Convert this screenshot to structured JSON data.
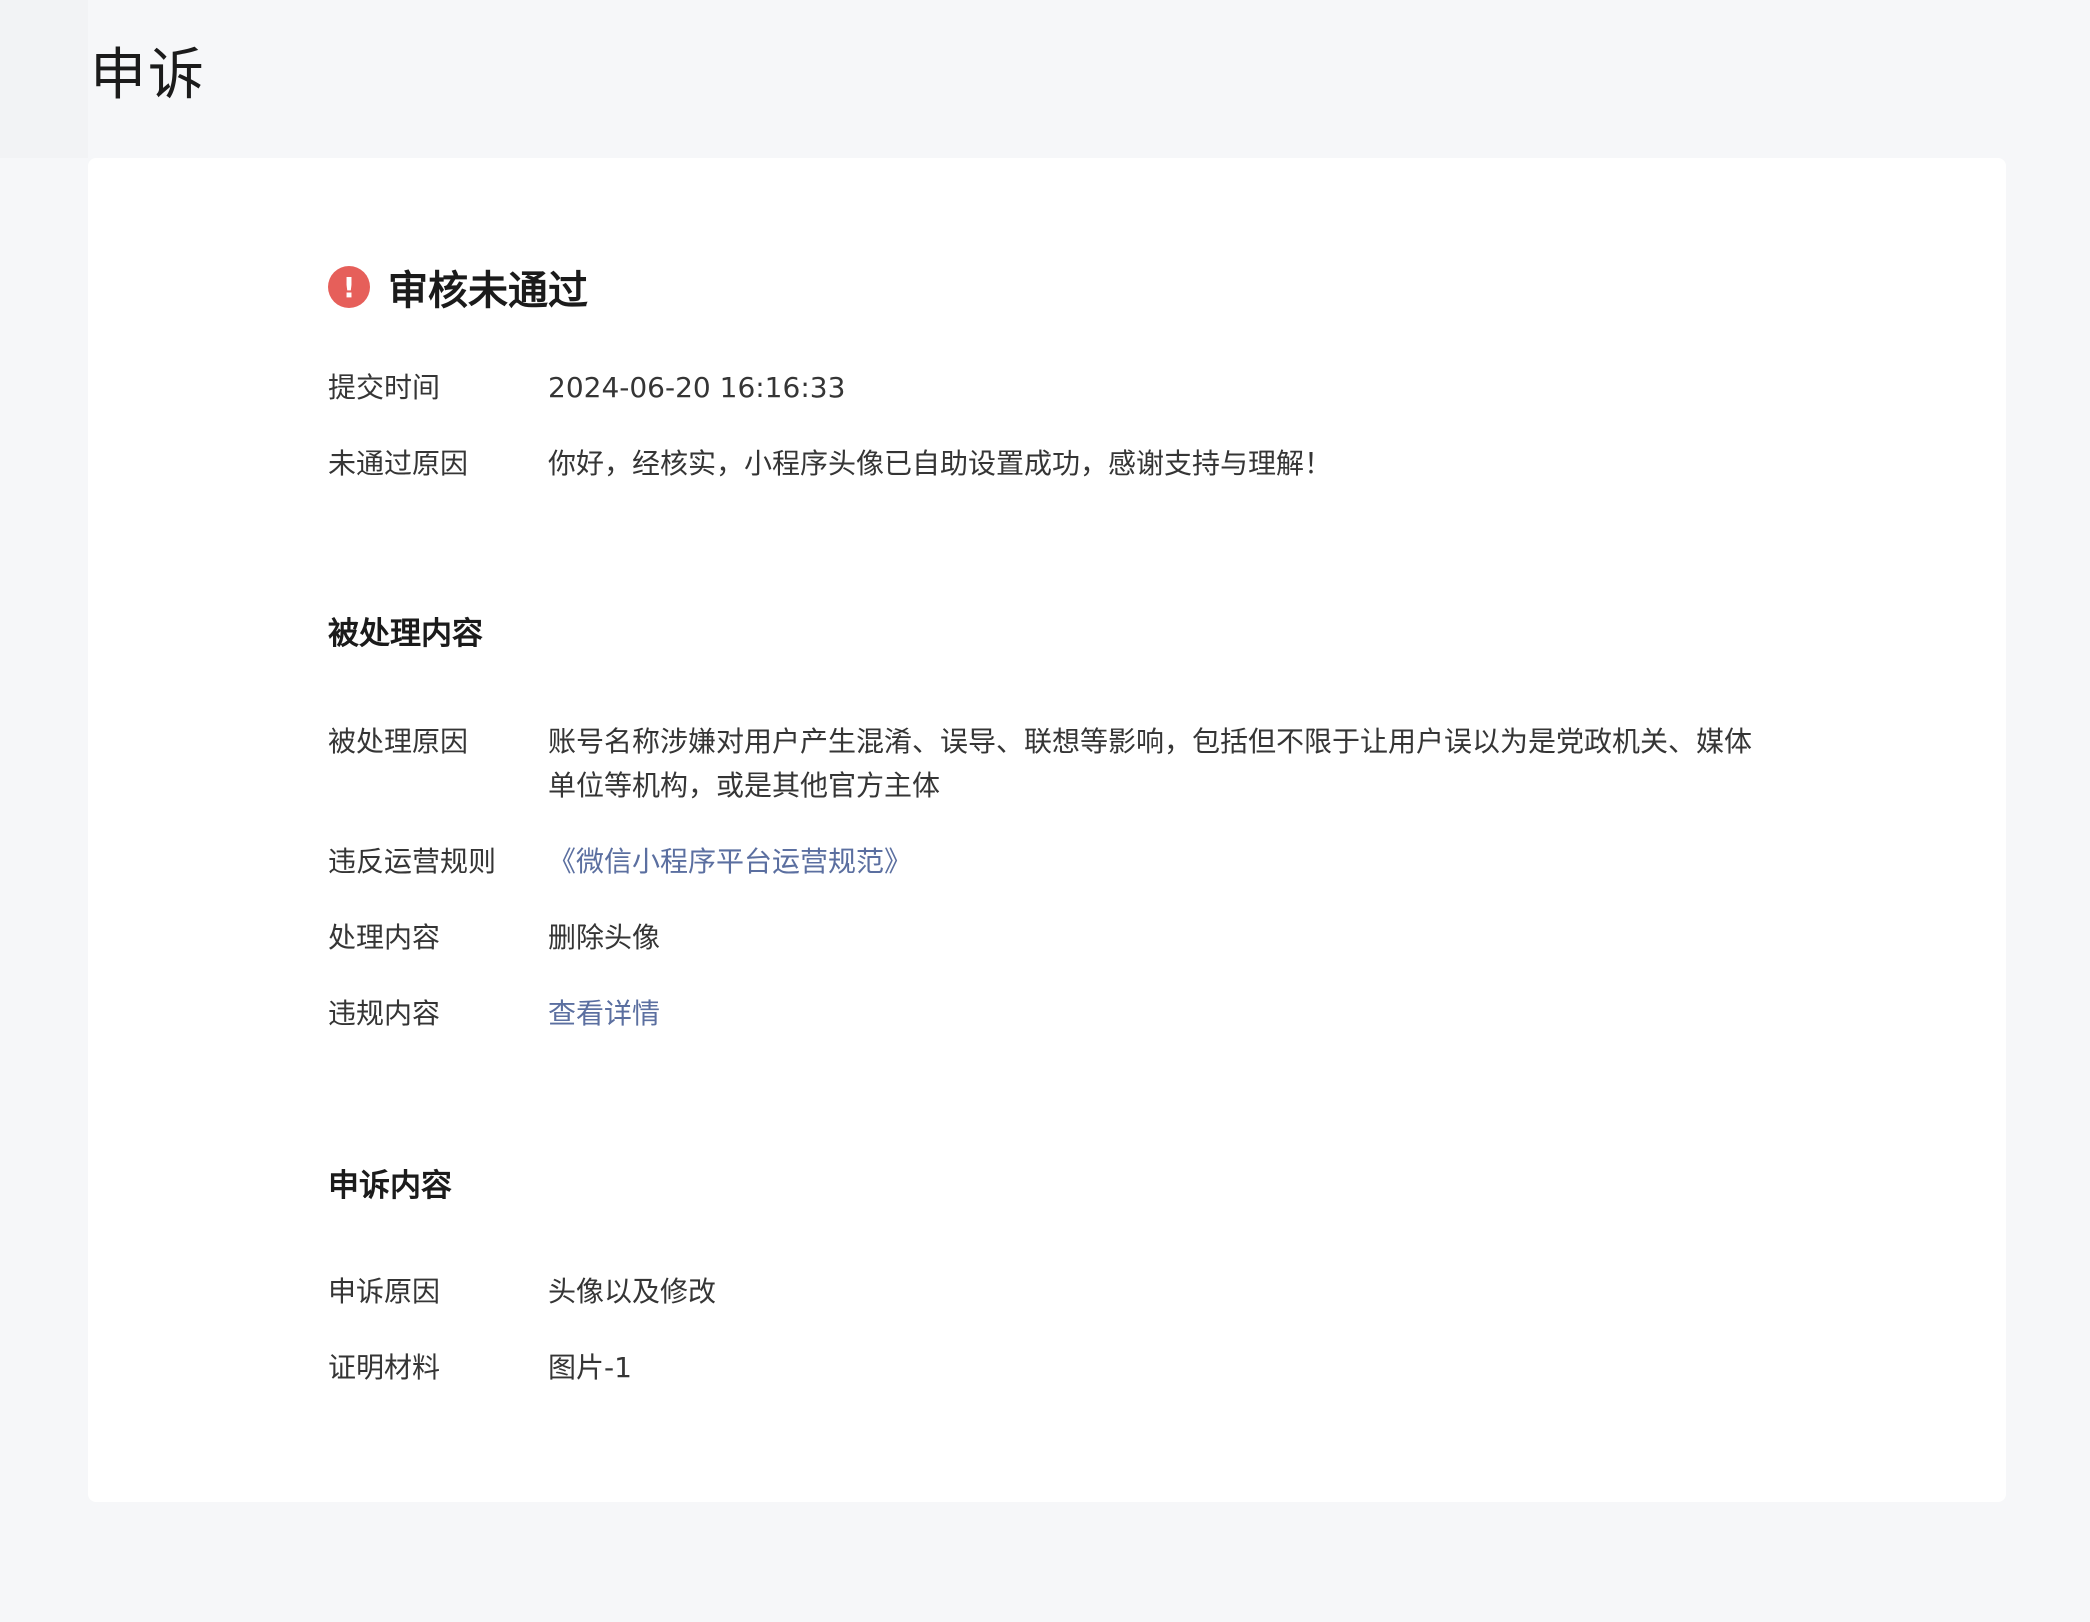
{
  "page": {
    "title": "申诉"
  },
  "status": {
    "icon": "exclamation-circle-icon",
    "icon_glyph": "!",
    "text": "审核未通过",
    "color": "#e65f5a"
  },
  "review": {
    "submit_time_label": "提交时间",
    "submit_time_value": "2024-06-20 16:16:33",
    "reject_reason_label": "未通过原因",
    "reject_reason_value": "你好，经核实，小程序头像已自助设置成功，感谢支持与理解！"
  },
  "processed": {
    "section_title": "被处理内容",
    "reason_label": "被处理原因",
    "reason_value": "账号名称涉嫌对用户产生混淆、误导、联想等影响，包括但不限于让用户误以为是党政机关、媒体单位等机构，或是其他官方主体",
    "rule_label": "违反运营规则",
    "rule_value": "《微信小程序平台运营规范》",
    "action_label": "处理内容",
    "action_value": "删除头像",
    "violation_label": "违规内容",
    "violation_value": "查看详情"
  },
  "appeal": {
    "section_title": "申诉内容",
    "reason_label": "申诉原因",
    "reason_value": "头像以及修改",
    "evidence_label": "证明材料",
    "evidence_value": "图片-1"
  },
  "colors": {
    "link": "#5b6fa0",
    "background": "#f6f7f9",
    "card": "#ffffff"
  }
}
